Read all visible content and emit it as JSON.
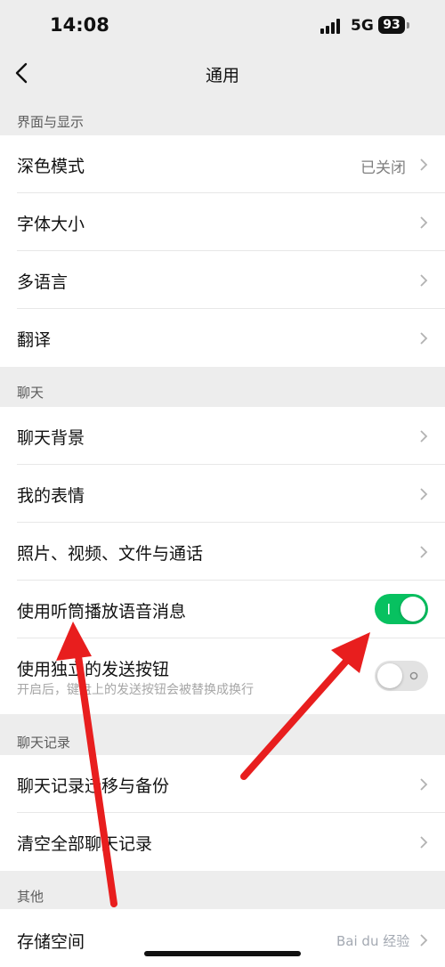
{
  "status": {
    "time": "14:08",
    "network": "5G",
    "battery": "93"
  },
  "nav": {
    "title": "通用"
  },
  "sections": [
    {
      "header": "界面与显示",
      "rows": [
        {
          "label": "深色模式",
          "value": "已关闭"
        },
        {
          "label": "字体大小"
        },
        {
          "label": "多语言"
        },
        {
          "label": "翻译"
        }
      ]
    },
    {
      "header": "聊天",
      "rows": [
        {
          "label": "聊天背景"
        },
        {
          "label": "我的表情"
        },
        {
          "label": "照片、视频、文件与通话"
        },
        {
          "label": "使用听筒播放语音消息",
          "toggle": true
        },
        {
          "label": "使用独立的发送按钮",
          "sub": "开启后，键盘上的发送按钮会被替换成换行",
          "toggle": false
        }
      ]
    },
    {
      "header": "聊天记录",
      "rows": [
        {
          "label": "聊天记录迁移与备份"
        },
        {
          "label": "清空全部聊天记录"
        }
      ]
    },
    {
      "header": "其他",
      "rows": [
        {
          "label": "存储空间"
        }
      ]
    }
  ],
  "watermark": "Bai du 经验",
  "colors": {
    "accent": "#07c160",
    "background": "#ededed",
    "annotation": "#e81e1e"
  }
}
